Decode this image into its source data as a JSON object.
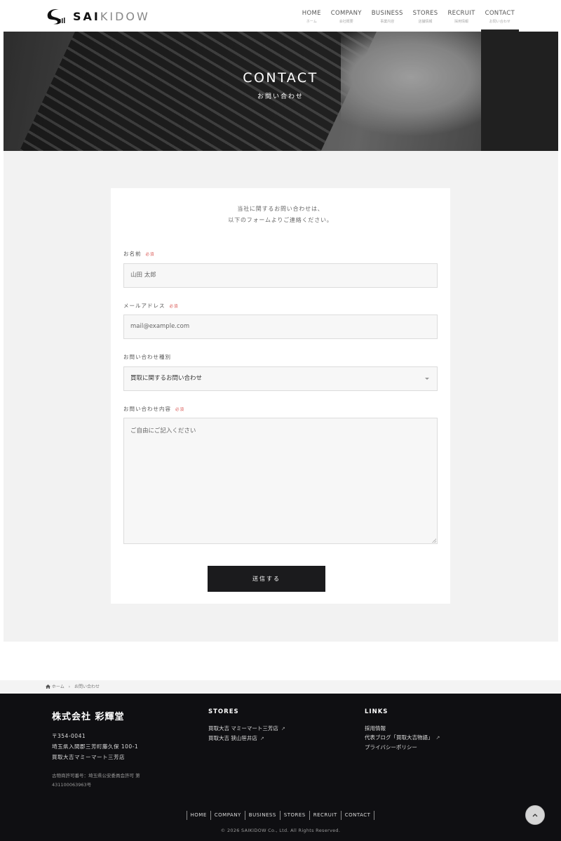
{
  "brand": {
    "logo_a": "SAI",
    "logo_b": "KIDOW"
  },
  "nav": [
    {
      "en": "HOME",
      "ja": "ホーム"
    },
    {
      "en": "COMPANY",
      "ja": "会社概要"
    },
    {
      "en": "BUSINESS",
      "ja": "事業内容"
    },
    {
      "en": "STORES",
      "ja": "店舗情報"
    },
    {
      "en": "RECRUIT",
      "ja": "採用情報"
    },
    {
      "en": "CONTACT",
      "ja": "お問い合わせ"
    }
  ],
  "hero": {
    "title": "CONTACT",
    "subtitle": "お問い合わせ"
  },
  "form": {
    "intro_line1": "当社に関するお問い合わせは、",
    "intro_line2": "以下のフォームよりご連絡ください。",
    "required_label": "必須",
    "name": {
      "label": "お名前",
      "placeholder": "山田 太郎"
    },
    "email": {
      "label": "メールアドレス",
      "placeholder": "mail@example.com"
    },
    "type": {
      "label": "お問い合わせ種別",
      "selected": "買取に関するお問い合わせ"
    },
    "message": {
      "label": "お問い合わせ内容",
      "placeholder": "ご自由にご記入ください"
    },
    "submit": "送信する"
  },
  "breadcrumb": {
    "home": "ホーム",
    "current": "お問い合わせ"
  },
  "footer": {
    "company": "株式会社 彩輝堂",
    "postal": "〒354-0041",
    "address": "埼玉県入間郡三芳町藤久保 100-1",
    "store": "買取大吉マミーマート三芳店",
    "license": "古物商許可番号：埼玉県公安委員会許可 第431100063963号",
    "stores_heading": "STORES",
    "stores": [
      "買取大吉 マミーマート三芳店",
      "買取大吉 狭山笹井店"
    ],
    "links_heading": "LINKS",
    "links": [
      "採用情報",
      "代表ブログ「買取大吉物語」",
      "プライバシーポリシー"
    ],
    "nav": [
      "HOME",
      "COMPANY",
      "BUSINESS",
      "STORES",
      "RECRUIT",
      "CONTACT"
    ],
    "copyright": "© 2026 SAIKIDOW Co., Ltd. All Rights Reserved."
  }
}
